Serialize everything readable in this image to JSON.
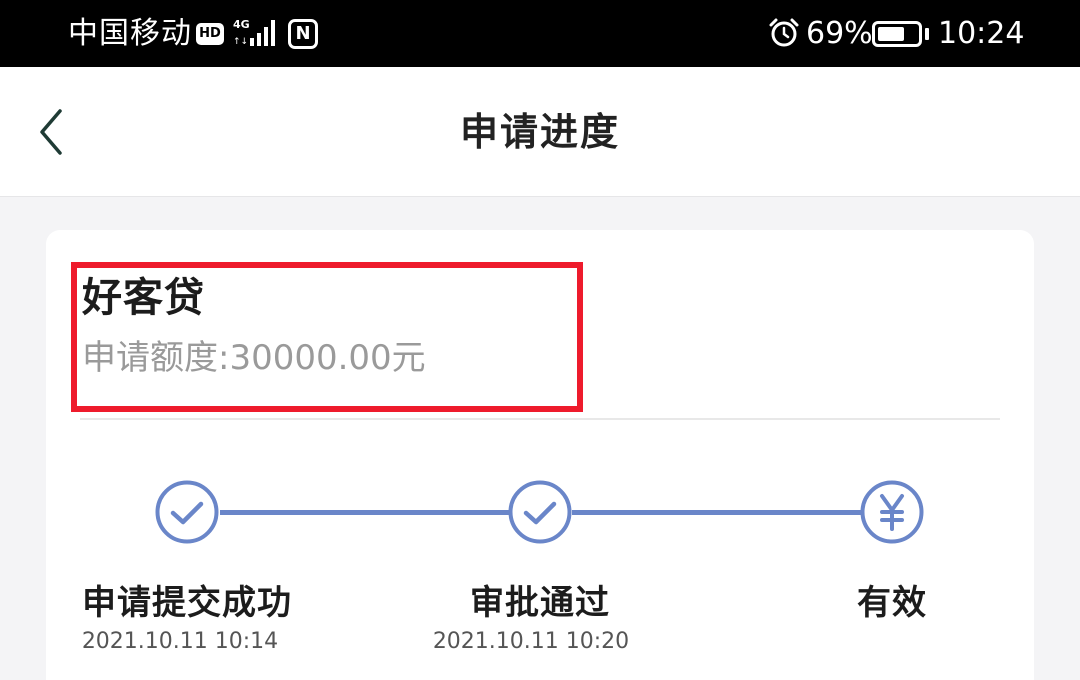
{
  "status_bar": {
    "carrier": "中国移动",
    "hd_badge": "HD",
    "network": "4G",
    "nfc_label": "N",
    "battery_percent": "69%",
    "battery_level": 0.69,
    "time": "10:24"
  },
  "header": {
    "title": "申请进度",
    "back_icon": "chevron-left-icon"
  },
  "card": {
    "product_name": "好客贷",
    "amount_label": "申请额度:30000.00元",
    "highlight_color": "#ee1b2c"
  },
  "progress": {
    "accent_color": "#6a86c9",
    "steps": [
      {
        "label": "申请提交成功",
        "time": "2021.10.11 10:14",
        "icon": "check-circle-icon"
      },
      {
        "label": "审批通过",
        "time": "2021.10.11 10:20",
        "icon": "check-circle-icon"
      },
      {
        "label": "有效",
        "time": "",
        "icon": "yuan-circle-icon"
      }
    ]
  }
}
